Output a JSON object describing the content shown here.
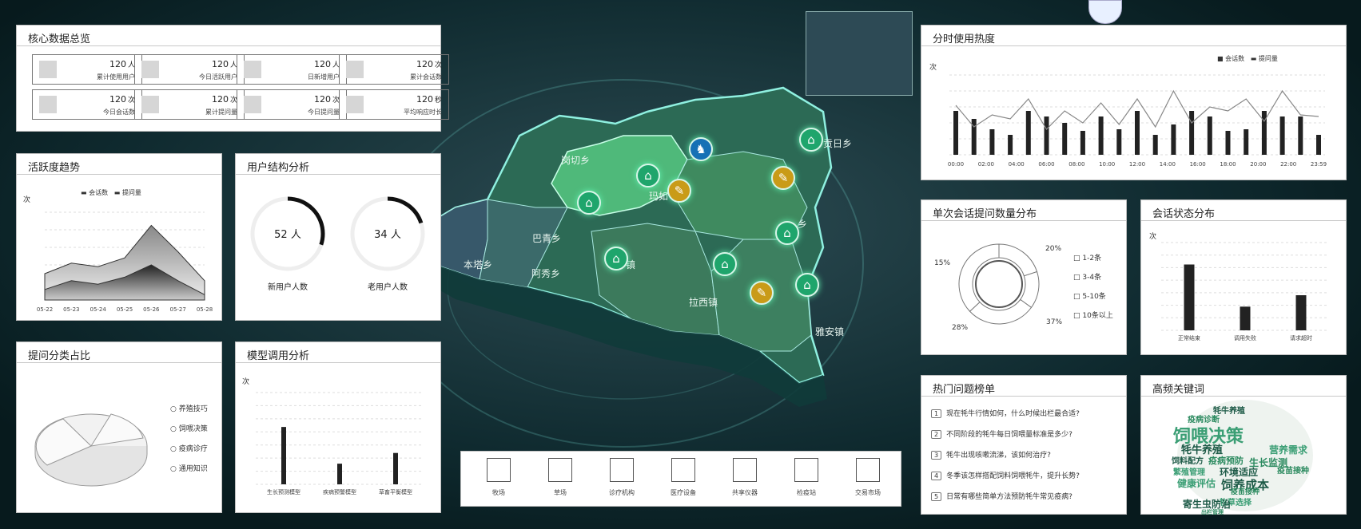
{
  "core": {
    "title": "核心数据总览",
    "cards": [
      {
        "value": "120",
        "unit": "人",
        "label": "累计使用用户"
      },
      {
        "value": "120",
        "unit": "人",
        "label": "今日活跃用户"
      },
      {
        "value": "120",
        "unit": "人",
        "label": "日新增用户"
      },
      {
        "value": "120",
        "unit": "次",
        "label": "累计会话数"
      },
      {
        "value": "120",
        "unit": "次",
        "label": "今日会话数"
      },
      {
        "value": "120",
        "unit": "次",
        "label": "累计提问量"
      },
      {
        "value": "120",
        "unit": "次",
        "label": "今日提问量"
      },
      {
        "value": "120",
        "unit": "秒",
        "label": "平均响应时长"
      }
    ]
  },
  "activity": {
    "title": "活跃度趋势",
    "ylabel": "次",
    "legend": [
      "会话数",
      "提问量"
    ]
  },
  "user_struct": {
    "title": "用户结构分析",
    "new": {
      "value": "52 人",
      "label": "新用户人数",
      "fraction": 0.3
    },
    "old": {
      "value": "34 人",
      "label": "老用户人数",
      "fraction": 0.2
    }
  },
  "question_cat": {
    "title": "提问分类占比",
    "items": [
      "养殖技巧",
      "饲喂决策",
      "疫病诊疗",
      "通用知识"
    ]
  },
  "model_call": {
    "title": "模型调用分析",
    "ylabel": "次"
  },
  "hourly": {
    "title": "分时使用热度",
    "ylabel": "次",
    "legend": [
      "会话数",
      "提问量"
    ]
  },
  "single_q": {
    "title": "单次会话提问数量分布",
    "legend": [
      "1-2条",
      "3-4条",
      "5-10条",
      "10条以上"
    ],
    "pcts": [
      "20%",
      "15%",
      "28%",
      "37%"
    ]
  },
  "session_status": {
    "title": "会话状态分布",
    "ylabel": "次"
  },
  "hot_q": {
    "title": "热门问题榜单",
    "items": [
      {
        "n": "1",
        "text": "现在牦牛行情如何，什么时候出栏最合适?"
      },
      {
        "n": "2",
        "text": "不同阶段的牦牛每日饲喂量标准是多少?"
      },
      {
        "n": "3",
        "text": "牦牛出现咳嗽流涕，该如何治疗?"
      },
      {
        "n": "4",
        "text": "冬季该怎样搭配饲料饲喂牦牛，提升长势?"
      },
      {
        "n": "5",
        "text": "日常有哪些简单方法预防牦牛常见疫病?"
      }
    ]
  },
  "keywords": {
    "title": "高频关键词",
    "words": [
      "牦牛养殖",
      "疫病诊断",
      "饲喂决策",
      "牦牛养殖",
      "疫病预防",
      "营养需求",
      "饲料配方",
      "生长监测",
      "繁殖管理",
      "环境适应",
      "疫苗接种",
      "健康评估",
      "饲养成本",
      "疫苗接种",
      "牧草选择",
      "寄生虫防治",
      "出栏管理"
    ]
  },
  "map": {
    "labels": [
      "岗切乡",
      "贡日乡",
      "巴青乡",
      "玛如",
      "本塔乡",
      "阿秀乡",
      "镇",
      "乡",
      "拉西镇",
      "雅安镇"
    ]
  },
  "nav": [
    "牧场",
    "草场",
    "诊疗机构",
    "医疗设备",
    "共享仪器",
    "检疫站",
    "交易市场"
  ],
  "chart_data": [
    {
      "type": "area",
      "title": "活跃度趋势",
      "categories": [
        "05-22",
        "05-23",
        "05-24",
        "05-25",
        "05-26",
        "05-27",
        "05-28"
      ],
      "series": [
        {
          "name": "会话数",
          "values": [
            30,
            42,
            38,
            48,
            85,
            55,
            22
          ]
        },
        {
          "name": "提问量",
          "values": [
            12,
            22,
            18,
            26,
            40,
            22,
            6
          ]
        }
      ],
      "ylabel": "次",
      "ylim": [
        0,
        100
      ]
    },
    {
      "type": "bar",
      "title": "模型调用分析",
      "categories": [
        "生长预测模型",
        "疾病预警模型",
        "草畜平衡模型"
      ],
      "values": [
        75,
        27,
        41
      ],
      "ylabel": "次",
      "ylim": [
        0,
        120
      ]
    },
    {
      "type": "bar",
      "title": "分时使用热度",
      "categories": [
        "00:00",
        "02:00",
        "04:00",
        "06:00",
        "08:00",
        "10:00",
        "12:00",
        "14:00",
        "16:00",
        "18:00",
        "20:00",
        "22:00",
        "23:59"
      ],
      "series": [
        {
          "name": "会话数",
          "values": [
            55,
            45,
            32,
            25,
            55,
            48,
            40,
            30,
            48,
            32,
            55,
            25,
            38,
            55,
            48,
            30,
            32,
            55,
            48,
            48,
            25
          ]
        },
        {
          "name": "提问量",
          "values": [
            62,
            35,
            50,
            45,
            70,
            32,
            55,
            40,
            65,
            38,
            70,
            35,
            80,
            40,
            60,
            55,
            70,
            42,
            80,
            50,
            48
          ]
        }
      ],
      "ylabel": "次",
      "ylim": [
        0,
        100
      ]
    },
    {
      "type": "pie",
      "title": "单次会话提问数量分布",
      "categories": [
        "1-2条",
        "3-4条",
        "5-10条",
        "10条以上"
      ],
      "values": [
        20,
        15,
        28,
        37
      ]
    },
    {
      "type": "bar",
      "title": "会话状态分布",
      "categories": [
        "正常结束",
        "调用失败",
        "请求超时"
      ],
      "values": [
        75,
        27,
        40
      ],
      "ylabel": "次",
      "ylim": [
        0,
        100
      ]
    }
  ]
}
